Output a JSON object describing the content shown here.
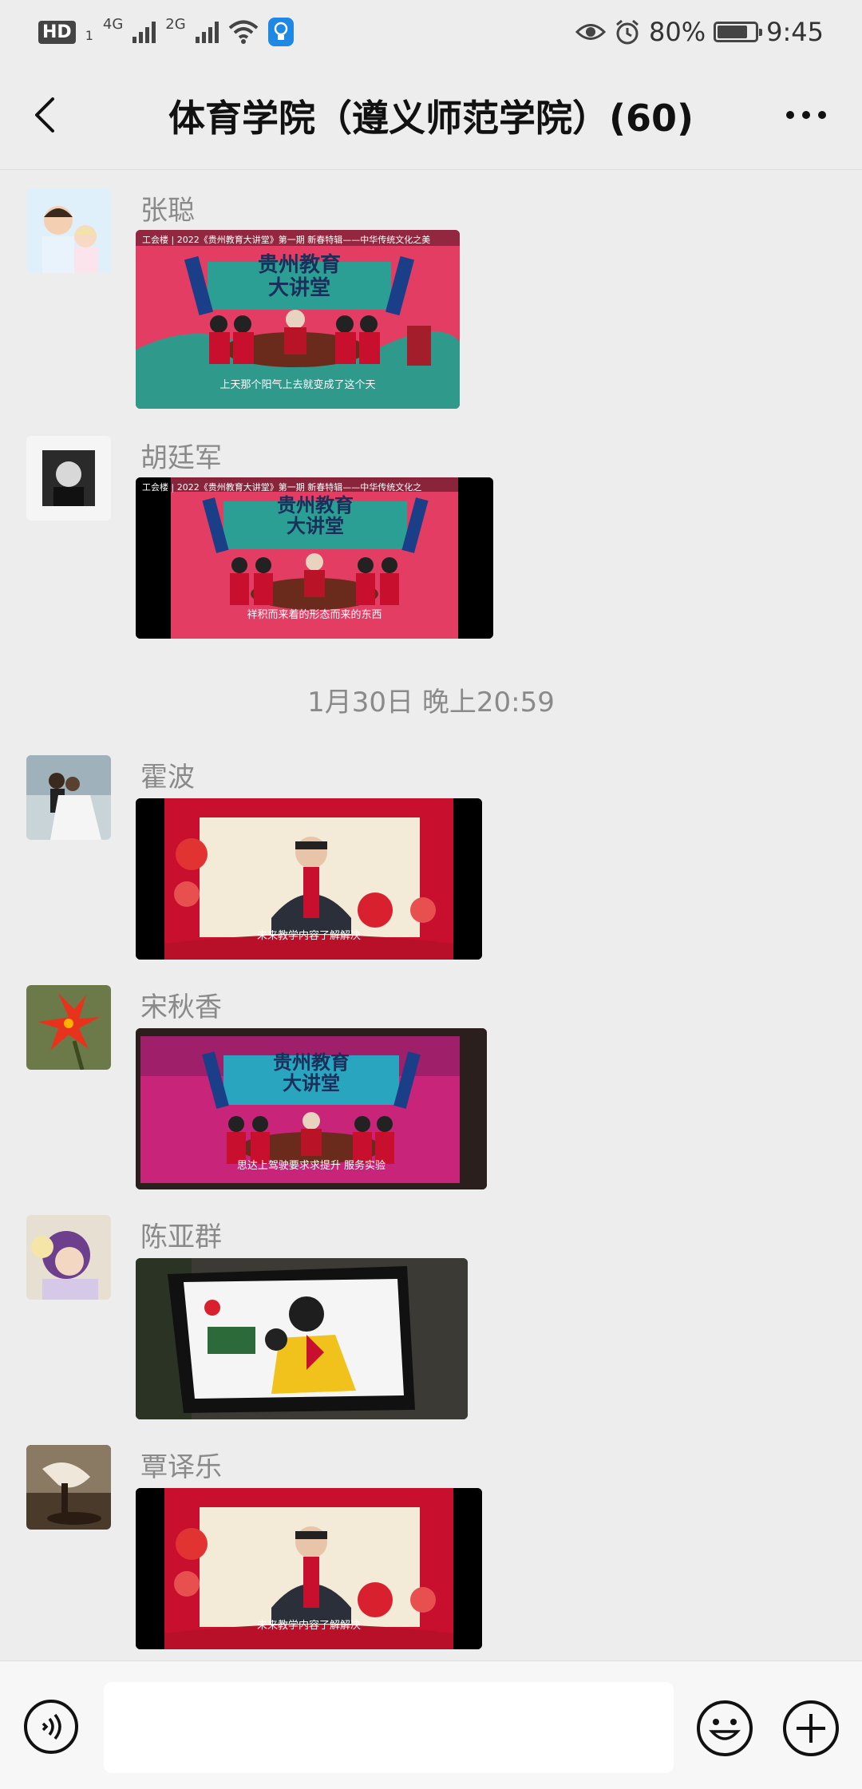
{
  "status_bar": {
    "left": {
      "hd": "HD",
      "sim1": "1",
      "net1": "4G",
      "net2": "2G"
    },
    "right": {
      "battery": "80%",
      "time": "9:45",
      "battery_level": 0.8
    }
  },
  "header": {
    "title": "体育学院（遵义师范学院）(60)",
    "icons": [
      "back-arrow-icon",
      "more-dots-icon"
    ]
  },
  "messages": [
    {
      "sender": "张聪",
      "type": "video",
      "video_title": "工会楼 | 2022《贵州教育大讲堂》第一期 新春特辑——中华传统文化之美",
      "scroll": "贵州教育 大讲堂",
      "caption": "上天那个阳气上去就变成了这个天"
    },
    {
      "sender": "胡廷军",
      "type": "video",
      "video_title": "工会楼 | 2022《贵州教育大讲堂》第一期 新春特辑——中华传统文化之",
      "scroll": "贵州教育 大讲堂",
      "caption": "祥积而来着的形态而来的东西"
    },
    {
      "sender": "霍波",
      "type": "video",
      "caption": "未来教学内容了解解决"
    },
    {
      "sender": "宋秋香",
      "type": "video",
      "scroll": "贵州教育 大讲堂",
      "caption": "思达上驾驶要求求提升 服务实验"
    },
    {
      "sender": "陈亚群",
      "type": "video",
      "caption": ""
    },
    {
      "sender": "覃译乐",
      "type": "video",
      "caption": "未来教学内容了解解决"
    }
  ],
  "timestamp": "1月30日 晚上20:59",
  "bottom_bar": {
    "icons": [
      "voice-icon",
      "emoji-icon",
      "plus-icon"
    ],
    "input_placeholder": ""
  },
  "colors": {
    "background": "#ededed",
    "sender": "#8a8a8a",
    "red": "#e8283c"
  }
}
